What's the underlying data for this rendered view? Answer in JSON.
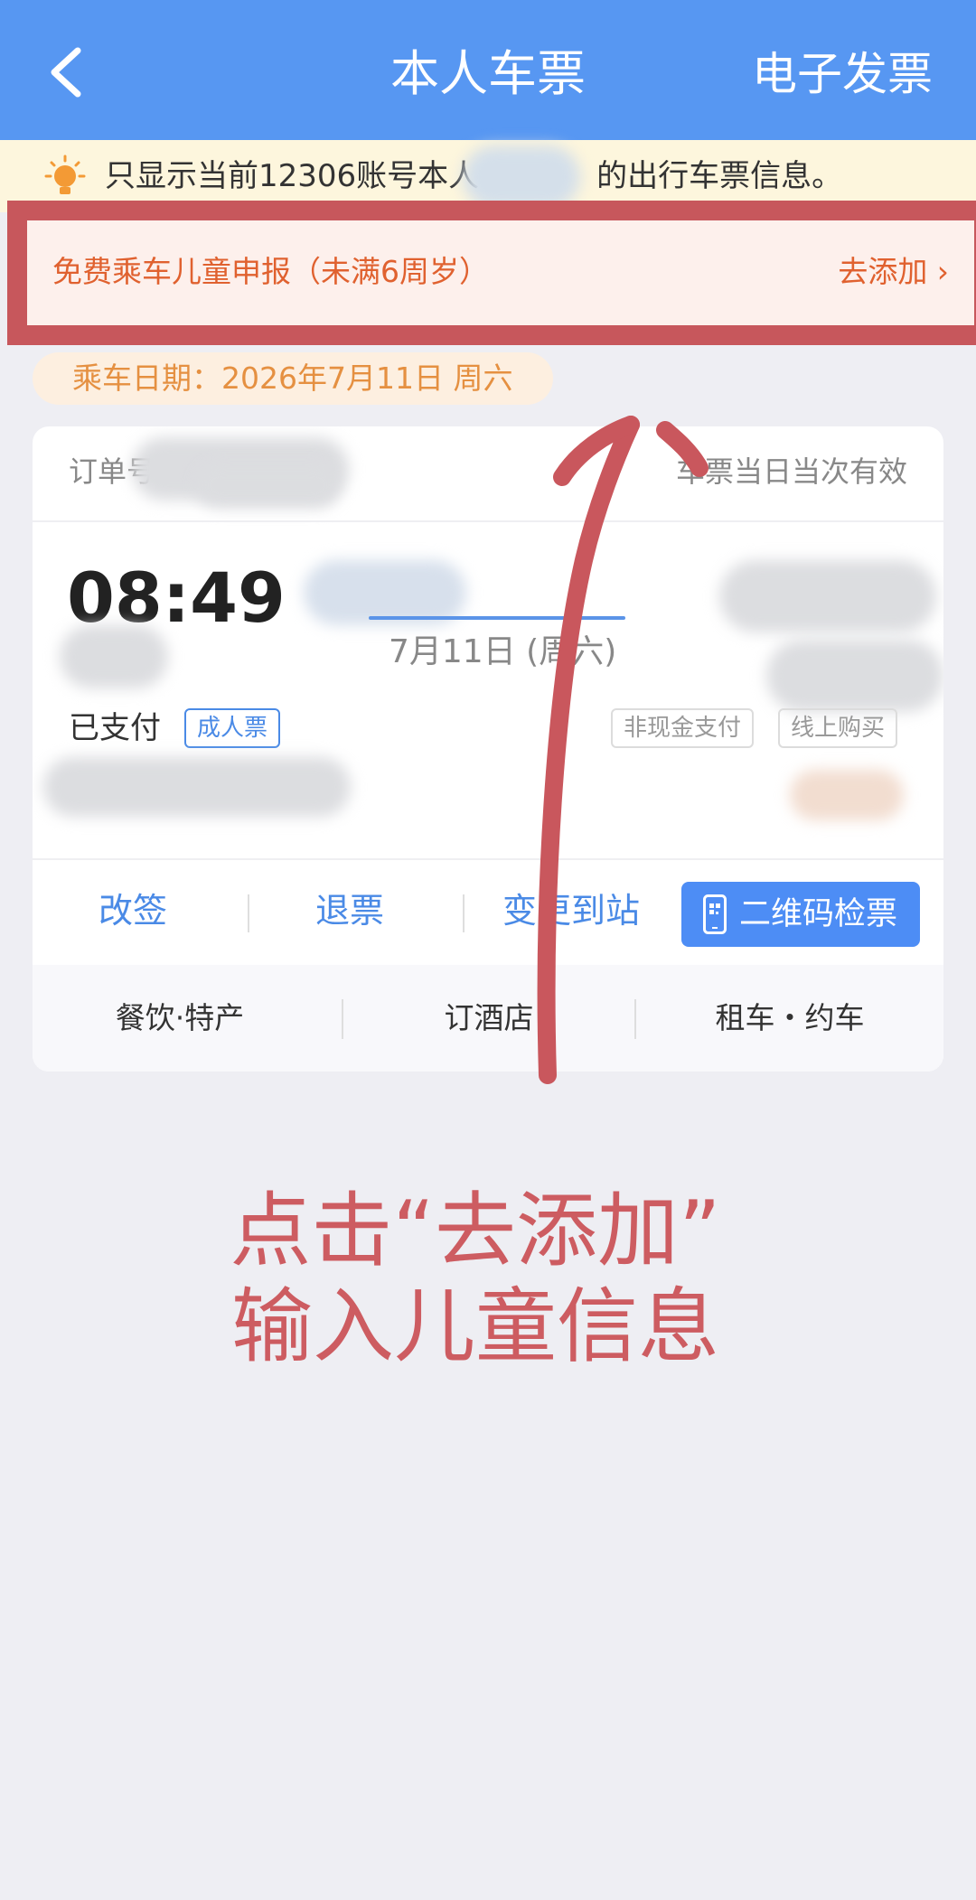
{
  "header": {
    "title": "本人车票",
    "invoice_label": "电子发票",
    "back_icon": "chevron-left-icon",
    "background": "#5797f2"
  },
  "notice": {
    "text": "只显示当前12306账号本人",
    "text_after": "的出行车票信息。",
    "icon": "lightbulb-icon"
  },
  "child_declaration": {
    "text": "免费乘车儿童申报（未满6周岁）",
    "action": "去添加 ›",
    "highlight_color": "#c7575c"
  },
  "ride_date": "乘车日期：2026年7月11日 周六",
  "ticket": {
    "order_label": "订单号：",
    "valid_note": "车票当日当次有效",
    "depart_time": "08:49",
    "trip_date": "7月11日 (周六)",
    "status": "已支付",
    "ticket_type": "成人票",
    "tags": [
      "非现金支付",
      "线上购买"
    ],
    "actions": [
      "改签",
      "退票",
      "变更到站"
    ],
    "qr_button": "二维码检票",
    "services": [
      "餐饮·特产",
      "订酒店",
      "租车・约车"
    ]
  },
  "annotation": {
    "line1": "点击“去添加”",
    "line2": "输入儿童信息",
    "color": "#cd5c61"
  }
}
